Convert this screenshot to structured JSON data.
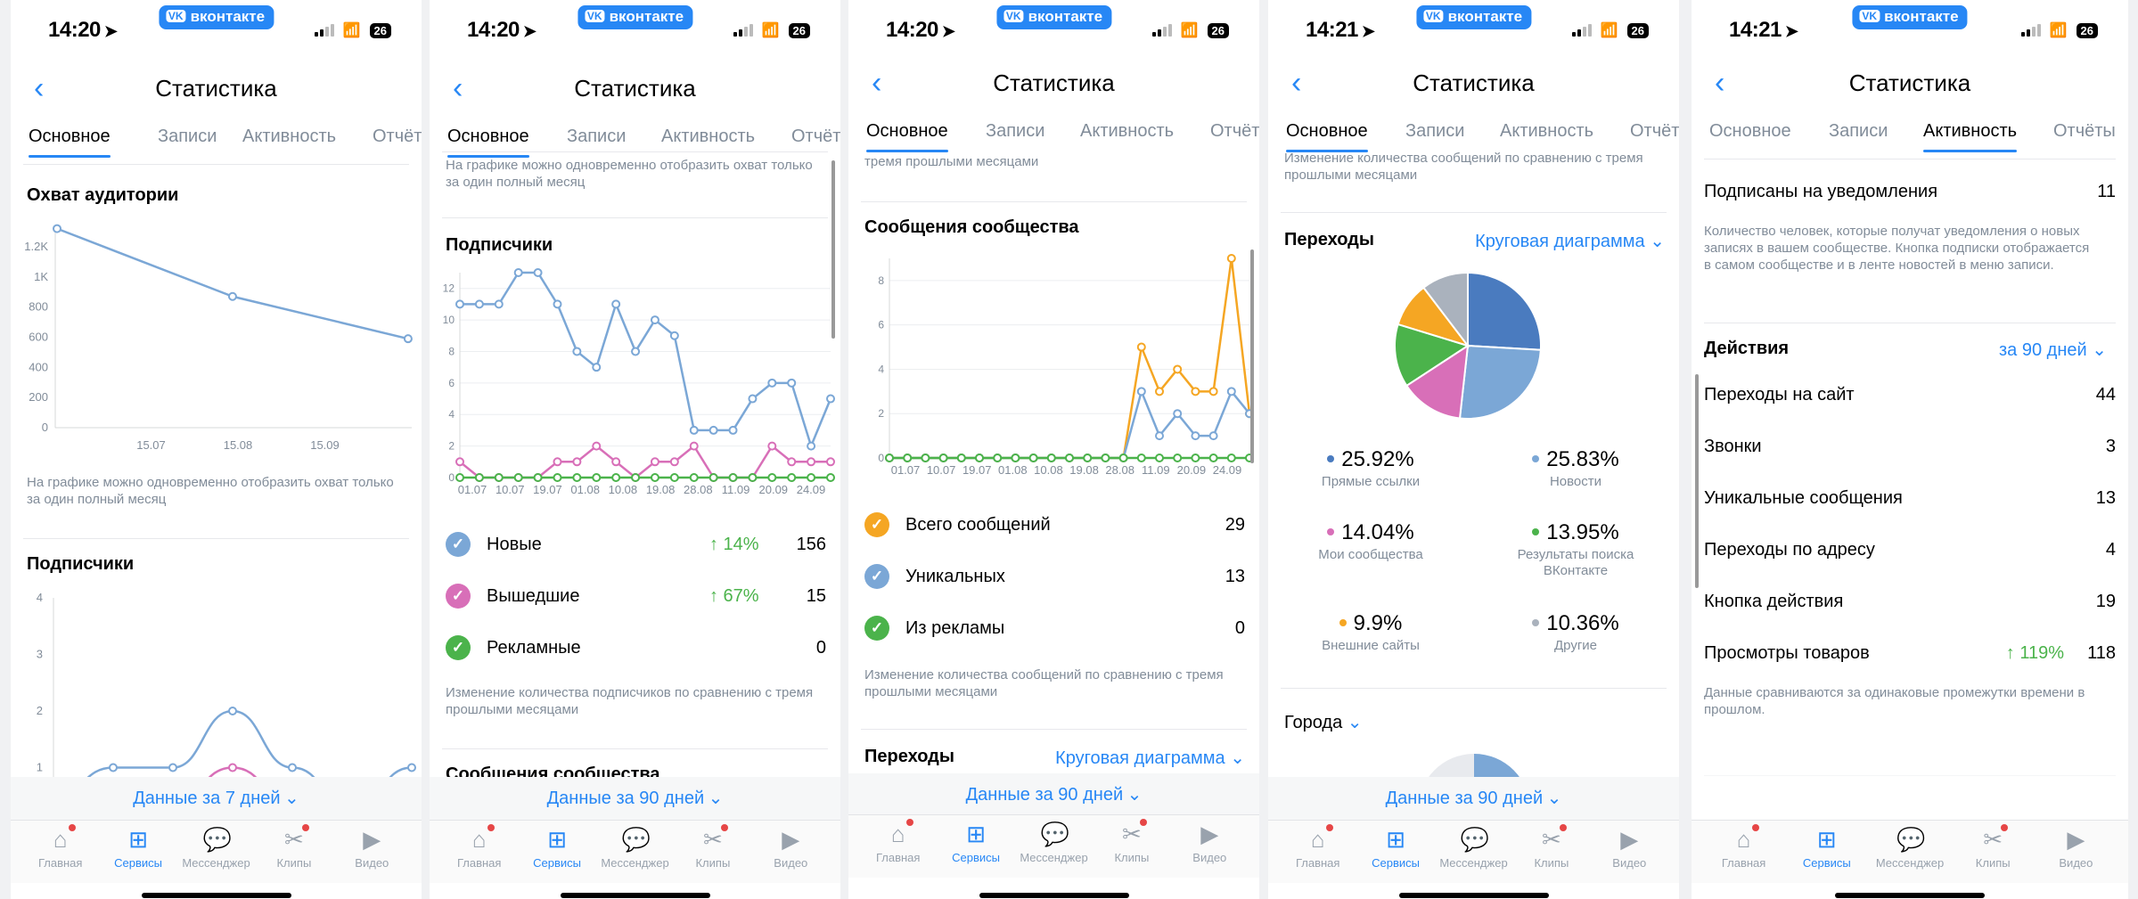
{
  "status": {
    "times": [
      "14:20",
      "14:20",
      "14:20",
      "14:21",
      "14:21"
    ],
    "vk_label": "вконтакте",
    "battery": "26"
  },
  "nav": {
    "title": "Статистика"
  },
  "tabs": [
    "Основное",
    "Записи",
    "Активность",
    "Отчёты"
  ],
  "tabbar": [
    "Главная",
    "Сервисы",
    "Мессенджер",
    "Клипы",
    "Видео"
  ],
  "colors": {
    "accent": "#2787f5",
    "blue_line": "#7ba7d6",
    "pink": "#d86fb8",
    "green": "#4bb34b",
    "orange": "#f5a623"
  },
  "screen1": {
    "reach_title": "Охват аудитории",
    "reach_note": "На графике можно одновременно отобразить охват только за один полный месяц",
    "subscribers_title": "Подписчики",
    "period_button": "Данные за 7 дней"
  },
  "screen2": {
    "top_note": "На графике можно одновременно отобразить охват только за один полный месяц",
    "subscribers_title": "Подписчики",
    "legend": [
      {
        "label": "Новые",
        "pct": "↑ 14%",
        "value": "156",
        "color": "#7ba7d6"
      },
      {
        "label": "Вышедшие",
        "pct": "↑ 67%",
        "value": "15",
        "color": "#d86fb8"
      },
      {
        "label": "Рекламные",
        "pct": "",
        "value": "0",
        "color": "#4bb34b"
      }
    ],
    "note": "Изменение количества подписчиков по сравнению с тремя прошлыми месяцами",
    "next_title": "Сообщения сообщества",
    "period_button": "Данные за 90 дней"
  },
  "screen3": {
    "top_note": "тремя прошлыми месяцами",
    "messages_title": "Сообщения сообщества",
    "legend": [
      {
        "label": "Всего сообщений",
        "value": "29",
        "color": "#f5a623"
      },
      {
        "label": "Уникальных",
        "value": "13",
        "color": "#7ba7d6"
      },
      {
        "label": "Из рекламы",
        "value": "0",
        "color": "#4bb34b"
      }
    ],
    "note": "Изменение количества сообщений по сравнению с тремя прошлыми месяцами",
    "transitions_title": "Переходы",
    "chart_select": "Круговая диаграмма",
    "period_button": "Данные за 90 дней"
  },
  "screen4": {
    "top_note": "Изменение количества сообщений по сравнению с тремя прошлыми месяцами",
    "transitions_title": "Переходы",
    "chart_select": "Круговая диаграмма",
    "pie_items": [
      {
        "value": "25.92%",
        "label": "Прямые ссылки",
        "color": "#4a7bbf"
      },
      {
        "value": "25.83%",
        "label": "Новости",
        "color": "#7ba7d6"
      },
      {
        "value": "14.04%",
        "label": "Мои сообщества",
        "color": "#d86fb8"
      },
      {
        "value": "13.95%",
        "label": "Результаты поиска ВКонтакте",
        "color": "#4bb34b"
      },
      {
        "value": "9.9%",
        "label": "Внешние сайты",
        "color": "#f5a623"
      },
      {
        "value": "10.36%",
        "label": "Другие",
        "color": "#aab2bd"
      }
    ],
    "cities_label": "Города",
    "period_button": "Данные за 90 дней"
  },
  "screen5": {
    "notif_label": "Подписаны на уведомления",
    "notif_value": "11",
    "notif_note": "Количество человек, которые получат уведомления о новых записях в вашем сообществе. Кнопка подписки отображается в самом сообществе и в ленте новостей в меню записи.",
    "actions_title": "Действия",
    "actions_period": "за 90 дней",
    "actions": [
      {
        "label": "Переходы на сайт",
        "value": "44",
        "pct": ""
      },
      {
        "label": "Звонки",
        "value": "3",
        "pct": ""
      },
      {
        "label": "Уникальные сообщения",
        "value": "13",
        "pct": ""
      },
      {
        "label": "Переходы по адресу",
        "value": "4",
        "pct": ""
      },
      {
        "label": "Кнопка действия",
        "value": "19",
        "pct": ""
      },
      {
        "label": "Просмотры товаров",
        "value": "118",
        "pct": "↑ 119%"
      }
    ],
    "actions_note": "Данные сравниваются за одинаковые промежутки времени в прошлом."
  },
  "chart_data": [
    {
      "type": "line",
      "title": "Охват аудитории",
      "x": [
        "15.06",
        "15.07",
        "15.08",
        "15.09",
        "15.10"
      ],
      "x_tick_labels": [
        "15.07",
        "15.08",
        "15.09"
      ],
      "y_tick_labels": [
        "0",
        "200",
        "400",
        "600",
        "800",
        "1K",
        "1.2K"
      ],
      "ylim": [
        0,
        1300
      ],
      "series": [
        {
          "values": [
            1320,
            null,
            870,
            null,
            590
          ]
        }
      ]
    },
    {
      "type": "line",
      "title": "Подписчики",
      "y_tick_labels": [
        "1",
        "2",
        "3",
        "4"
      ],
      "ylim": [
        0,
        4
      ],
      "series": [
        {
          "values": [
            0.5,
            1,
            1,
            2,
            1,
            0.3,
            1
          ]
        },
        {
          "values": [
            0,
            0.2,
            0.4,
            1,
            0.4,
            0,
            0
          ]
        }
      ]
    },
    {
      "type": "line",
      "title": "Подписчики",
      "x_tick_labels": [
        "01.07",
        "10.07",
        "19.07",
        "01.08",
        "10.08",
        "19.08",
        "28.08",
        "11.09",
        "20.09",
        "24.09"
      ],
      "y_tick_labels": [
        "0",
        "2",
        "4",
        "6",
        "8",
        "10",
        "12"
      ],
      "ylim": [
        0,
        13
      ],
      "series": [
        {
          "name": "Новые",
          "values": [
            11,
            11,
            11,
            13,
            13,
            11,
            8,
            7,
            11,
            8,
            10,
            9,
            3,
            3,
            3,
            5,
            6,
            6,
            2,
            5
          ]
        },
        {
          "name": "Вышедшие",
          "values": [
            1,
            0,
            0,
            0,
            0,
            1,
            1,
            2,
            1,
            0,
            1,
            1,
            2,
            0,
            0,
            0,
            2,
            1,
            1,
            1
          ]
        },
        {
          "name": "Рекламные",
          "values": [
            0,
            0,
            0,
            0,
            0,
            0,
            0,
            0,
            0,
            0,
            0,
            0,
            0,
            0,
            0,
            0,
            0,
            0,
            0,
            0
          ]
        }
      ]
    },
    {
      "type": "line",
      "title": "Сообщения сообщества",
      "x_tick_labels": [
        "01.07",
        "10.07",
        "19.07",
        "01.08",
        "10.08",
        "19.08",
        "28.08",
        "11.09",
        "20.09",
        "24.09"
      ],
      "y_tick_labels": [
        "0",
        "2",
        "4",
        "6",
        "8"
      ],
      "ylim": [
        0,
        9
      ],
      "series": [
        {
          "name": "Всего сообщений",
          "values": [
            0,
            0,
            0,
            0,
            0,
            0,
            0,
            0,
            0,
            0,
            0,
            0,
            0,
            0,
            5,
            3,
            4,
            3,
            3,
            9,
            2
          ]
        },
        {
          "name": "Уникальных",
          "values": [
            0,
            0,
            0,
            0,
            0,
            0,
            0,
            0,
            0,
            0,
            0,
            0,
            0,
            0,
            3,
            1,
            2,
            1,
            1,
            3,
            2
          ]
        },
        {
          "name": "Из рекламы",
          "values": [
            0,
            0,
            0,
            0,
            0,
            0,
            0,
            0,
            0,
            0,
            0,
            0,
            0,
            0,
            0,
            0,
            0,
            0,
            0,
            0,
            0
          ]
        }
      ]
    },
    {
      "type": "pie",
      "title": "Переходы",
      "categories": [
        "Прямые ссылки",
        "Новости",
        "Мои сообщества",
        "Результаты поиска ВКонтакте",
        "Внешние сайты",
        "Другие"
      ],
      "values": [
        25.92,
        25.83,
        14.04,
        13.95,
        9.9,
        10.36
      ]
    }
  ]
}
